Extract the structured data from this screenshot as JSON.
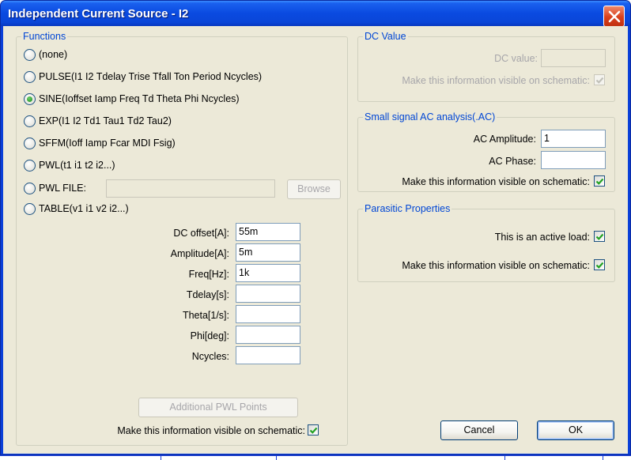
{
  "window": {
    "title": "Independent Current Source - I2"
  },
  "functions": {
    "legend": "Functions",
    "options": [
      {
        "label": "(none)",
        "selected": false
      },
      {
        "label": "PULSE(I1 I2 Tdelay Trise Tfall Ton Period Ncycles)",
        "selected": false
      },
      {
        "label": "SINE(Ioffset Iamp Freq Td Theta Phi Ncycles)",
        "selected": true
      },
      {
        "label": "EXP(I1 I2 Td1 Tau1 Td2 Tau2)",
        "selected": false
      },
      {
        "label": "SFFM(Ioff Iamp Fcar MDI Fsig)",
        "selected": false
      },
      {
        "label": "PWL(t1 i1 t2 i2...)",
        "selected": false
      },
      {
        "label": "PWL FILE:",
        "selected": false
      },
      {
        "label": "TABLE(v1 i1 v2 i2...)",
        "selected": false
      }
    ],
    "pwl_file_value": "",
    "browse_label": "Browse",
    "params": [
      {
        "label": "DC offset[A]:",
        "value": "55m"
      },
      {
        "label": "Amplitude[A]:",
        "value": "5m"
      },
      {
        "label": "Freq[Hz]:",
        "value": "1k"
      },
      {
        "label": "Tdelay[s]:",
        "value": ""
      },
      {
        "label": "Theta[1/s]:",
        "value": ""
      },
      {
        "label": "Phi[deg]:",
        "value": ""
      },
      {
        "label": "Ncycles:",
        "value": ""
      }
    ],
    "additional_pwl_label": "Additional PWL Points",
    "visible_label": "Make this information visible on schematic:",
    "visible_checked": true
  },
  "dc_value": {
    "legend": "DC Value",
    "dc_label": "DC value:",
    "dc_value": "",
    "visible_label": "Make this information visible on schematic:",
    "visible_checked": true
  },
  "ac": {
    "legend": "Small signal AC analysis(.AC)",
    "amplitude_label": "AC Amplitude:",
    "amplitude_value": "1",
    "phase_label": "AC Phase:",
    "phase_value": "",
    "visible_label": "Make this information visible on schematic:",
    "visible_checked": true
  },
  "parasitic": {
    "legend": "Parasitic Properties",
    "active_load_label": "This is an active load:",
    "active_load_checked": true,
    "visible_label": "Make this information visible on schematic:",
    "visible_checked": true
  },
  "buttons": {
    "cancel": "Cancel",
    "ok": "OK"
  },
  "colors": {
    "accent": "#0046d5",
    "titlebar": "#0a4ae0",
    "dialog_bg": "#ece9d8",
    "check": "#21a121"
  }
}
